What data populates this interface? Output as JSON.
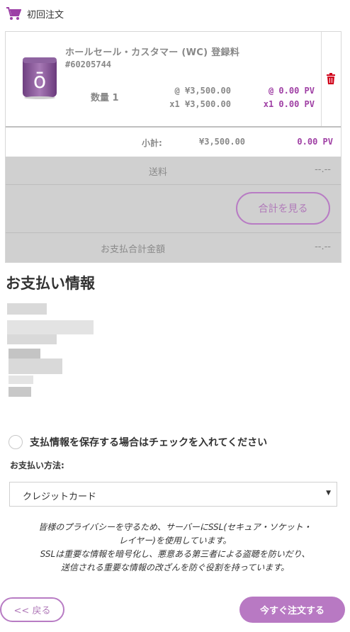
{
  "header": {
    "title": "初回注文",
    "icon": "shopping-cart-icon",
    "accent": "#9c3fa6"
  },
  "item": {
    "name": "ホールセール・カスタマー (WC) 登録料",
    "sku": "#60205744",
    "quantity_label": "数量 1",
    "unit_price": "@ ¥3,500.00",
    "line_price": "x1 ¥3,500.00",
    "unit_pv": "@ 0.00 PV",
    "line_pv": "x1 0.00 PV",
    "thumbnail_letter": "ō"
  },
  "subtotal": {
    "label": "小計:",
    "yen": "¥3,500.00",
    "pv": "0.00 PV"
  },
  "shipping": {
    "label": "送料",
    "value": "--.--"
  },
  "calc_button": "合計を見る",
  "total": {
    "label": "お支払合計金額",
    "value": "--.--"
  },
  "payment": {
    "title": "お支払い情報",
    "save_label": "支払情報を保存する場合はチェックを入れてください",
    "method_label": "お支払い方法:",
    "method_selected": "クレジットカード",
    "note_line1": "皆様のプライバシーを守るため、サーバーにSSL(セキュア・ソケット・",
    "note_line2": "レイヤー)を使用しています。",
    "note_line3": "SSLは重要な情報を暗号化し、悪意ある第三者による盗聴を防いだり、",
    "note_line4": "送信される重要な情報の改ざんを防ぐ役割を持っています。"
  },
  "actions": {
    "back": "<< 戻る",
    "order": "今すぐ注文する"
  },
  "colors": {
    "purple": "#9f3fa4",
    "button": "#b879c3",
    "grey_panel": "#d0d0d0",
    "delete": "#d0021b"
  }
}
